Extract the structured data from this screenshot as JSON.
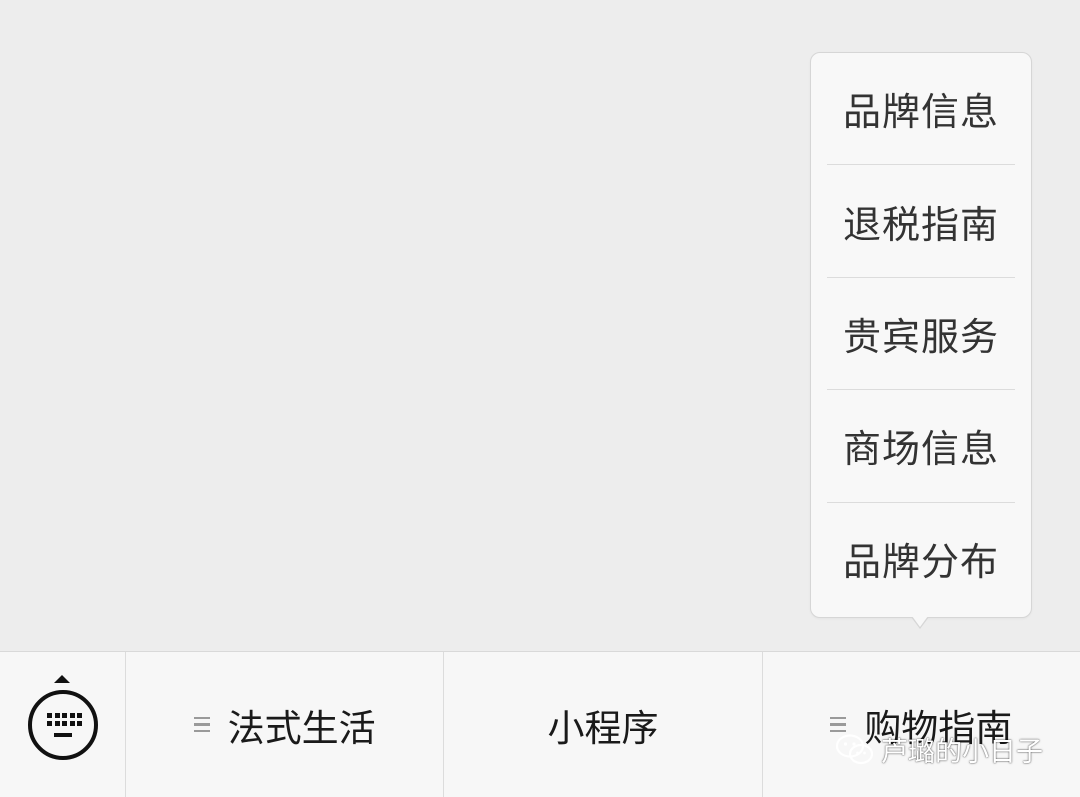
{
  "popup": {
    "items": [
      {
        "label": "品牌信息"
      },
      {
        "label": "退税指南"
      },
      {
        "label": "贵宾服务"
      },
      {
        "label": "商场信息"
      },
      {
        "label": "品牌分布"
      }
    ]
  },
  "menubar": {
    "keyboard_icon": "keyboard-icon",
    "items": [
      {
        "label": "法式生活",
        "has_submenu": true
      },
      {
        "label": "小程序",
        "has_submenu": false
      },
      {
        "label": "购物指南",
        "has_submenu": true
      }
    ]
  },
  "watermark": {
    "text": "芦璐的小日子",
    "icon": "wechat-icon"
  },
  "colors": {
    "background": "#ededed",
    "menubar": "#f7f7f7",
    "popup": "#f8f8f8",
    "divider": "#dcdcdc",
    "text": "#1a1a1a"
  }
}
